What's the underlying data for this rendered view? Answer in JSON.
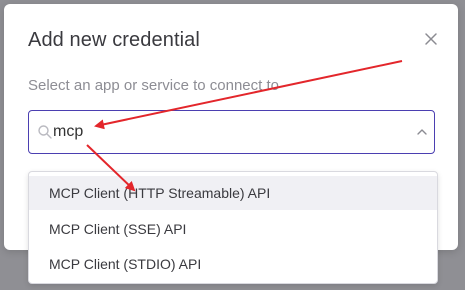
{
  "dialog": {
    "title": "Add new credential",
    "subtitle": "Select an app or service to connect to",
    "close_icon": "close-icon"
  },
  "search": {
    "value": "mcp",
    "icon": "search-icon",
    "chevron_icon": "chevron-up-icon"
  },
  "dropdown": {
    "options": [
      {
        "label": "MCP Client (HTTP Streamable) API",
        "highlighted": true
      },
      {
        "label": "MCP Client (SSE) API",
        "highlighted": false
      },
      {
        "label": "MCP Client (STDIO) API",
        "highlighted": false
      }
    ]
  },
  "annotation": {
    "arrow_color": "#e3262b"
  },
  "colors": {
    "focus_border": "#4b3fb1",
    "backdrop": "#8f8f94"
  }
}
